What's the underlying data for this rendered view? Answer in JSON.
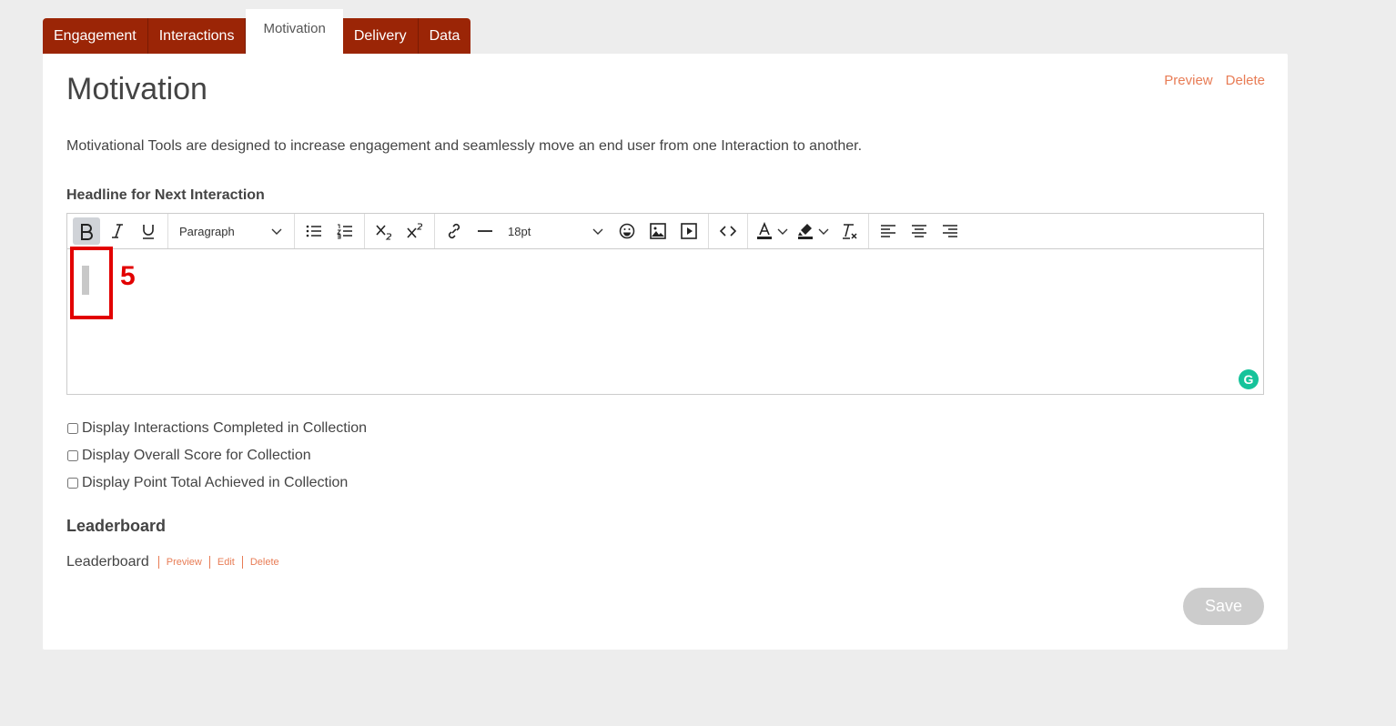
{
  "tabs": [
    {
      "label": "Engagement"
    },
    {
      "label": "Interactions"
    },
    {
      "label": "Motivation"
    },
    {
      "label": "Delivery"
    },
    {
      "label": "Data"
    }
  ],
  "active_tab": "Motivation",
  "page": {
    "title": "Motivation",
    "preview_label": "Preview",
    "delete_label": "Delete",
    "description": "Motivational Tools are designed to increase engagement and seamlessly move an end user from one Interaction to another."
  },
  "editor": {
    "label": "Headline for Next Interaction",
    "block_format": "Paragraph",
    "font_size": "18pt",
    "annotation_number": "5"
  },
  "checkboxes": [
    {
      "label": "Display Interactions Completed in Collection",
      "checked": false
    },
    {
      "label": "Display Overall Score for Collection",
      "checked": false
    },
    {
      "label": "Display Point Total Achieved in Collection",
      "checked": false
    }
  ],
  "leaderboard": {
    "section_title": "Leaderboard",
    "name": "Leaderboard",
    "preview_label": "Preview",
    "edit_label": "Edit",
    "delete_label": "Delete"
  },
  "save_label": "Save",
  "colors": {
    "tab_bg": "#9b2506",
    "link": "#e87c55",
    "annotation": "#e20000",
    "save_disabled": "#cccccc"
  }
}
